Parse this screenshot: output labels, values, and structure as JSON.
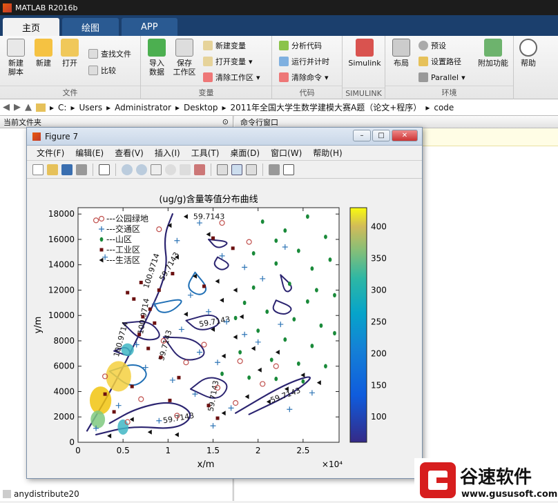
{
  "app": {
    "title": "MATLAB R2016b"
  },
  "tabs": [
    {
      "label": "主页",
      "active": true
    },
    {
      "label": "绘图",
      "active": false
    },
    {
      "label": "APP",
      "active": false
    }
  ],
  "ribbon": {
    "file_group": {
      "name": "文件",
      "new_script": "新建\n脚本",
      "new": "新建",
      "open": "打开",
      "find_files": "查找文件",
      "compare": "比较"
    },
    "variable_group": {
      "name": "变量",
      "import": "导入\n数据",
      "save_ws": "保存\n工作区",
      "new_var": "新建变量",
      "open_var": "打开变量",
      "clear_ws": "清除工作区"
    },
    "code_group": {
      "name": "代码",
      "analyze": "分析代码",
      "run_time": "运行并计时",
      "clear_cmd": "清除命令"
    },
    "simulink_group": {
      "name": "SIMULINK",
      "simulink": "Simulink"
    },
    "env_group": {
      "name": "环境",
      "layout": "布局",
      "prefs": "预设",
      "set_path": "设置路径",
      "parallel": "Parallel",
      "addons": "附加功能"
    },
    "help": "帮助"
  },
  "address": {
    "path": [
      "C:",
      "Users",
      "Administrator",
      "Desktop",
      "2011年全国大学生数学建模大赛A题（论文+程序）",
      "code"
    ]
  },
  "left_panel": {
    "title": "当前文件夹",
    "bottom_item": "anydistribute20"
  },
  "right_panel": {
    "title": "命令行窗口"
  },
  "figure": {
    "title": "Figure 7",
    "menu": [
      "文件(F)",
      "编辑(E)",
      "查看(V)",
      "插入(I)",
      "工具(T)",
      "桌面(D)",
      "窗口(W)",
      "帮助(H)"
    ]
  },
  "chart_data": {
    "type": "scatter",
    "title": "(ug/g)含量等值分布曲线",
    "xlabel": "x/m",
    "ylabel": "y/m",
    "x_multiplier": "×10⁴",
    "xlim": [
      0,
      2.9
    ],
    "ylim": [
      0,
      18500
    ],
    "xticks": [
      "0",
      "0.5",
      "1",
      "1.5",
      "2",
      "2.5"
    ],
    "yticks": [
      "0",
      "2000",
      "4000",
      "6000",
      "8000",
      "10000",
      "12000",
      "14000",
      "16000",
      "18000"
    ],
    "colorbar": {
      "ticks": [
        "100",
        "150",
        "200",
        "250",
        "300",
        "350",
        "400"
      ],
      "range": [
        60,
        430
      ]
    },
    "legend": [
      {
        "name": "---公园绿地",
        "marker": "circle",
        "color": "#c0504d"
      },
      {
        "name": "---交通区",
        "marker": "plus",
        "color": "#2e75b6"
      },
      {
        "name": "---山区",
        "marker": "dot",
        "color": "#1a8a3a"
      },
      {
        "name": "---工业区",
        "marker": "square",
        "color": "#6b1010"
      },
      {
        "name": "---生活区",
        "marker": "triangle",
        "color": "#111111"
      }
    ],
    "contour_labels": [
      "59.7143",
      "59.7143",
      "59.7143",
      "59.7143",
      "59.7143",
      "59.7143",
      "59.7143",
      "100.9714",
      "100.9714",
      "100.9714"
    ],
    "series": [
      {
        "name": "---公园绿地",
        "points": [
          [
            0.2,
            17500
          ],
          [
            0.9,
            16800
          ],
          [
            1.6,
            17300
          ],
          [
            1.9,
            15800
          ],
          [
            0.3,
            5200
          ],
          [
            0.7,
            3400
          ],
          [
            1.2,
            6300
          ],
          [
            0.95,
            8000
          ],
          [
            1.4,
            7700
          ],
          [
            1.8,
            6400
          ],
          [
            1.55,
            4300
          ],
          [
            2.05,
            4600
          ],
          [
            1.1,
            2100
          ],
          [
            0.55,
            1600
          ],
          [
            1.75,
            3100
          ],
          [
            2.2,
            6000
          ]
        ]
      },
      {
        "name": "---交通区",
        "points": [
          [
            0.3,
            14600
          ],
          [
            1.1,
            15900
          ],
          [
            1.35,
            17300
          ],
          [
            1.6,
            14700
          ],
          [
            2.3,
            15400
          ],
          [
            1.85,
            13800
          ],
          [
            2.05,
            12900
          ],
          [
            1.25,
            11600
          ],
          [
            0.85,
            10900
          ],
          [
            1.45,
            10300
          ],
          [
            1.65,
            9500
          ],
          [
            1.15,
            8900
          ],
          [
            0.65,
            7700
          ],
          [
            1.35,
            7100
          ],
          [
            1.85,
            8500
          ],
          [
            2.25,
            9300
          ],
          [
            1.55,
            6300
          ],
          [
            0.75,
            5900
          ],
          [
            1.05,
            4900
          ],
          [
            1.3,
            3800
          ],
          [
            1.7,
            2700
          ],
          [
            2.35,
            2600
          ],
          [
            0.45,
            2900
          ],
          [
            0.9,
            1700
          ],
          [
            1.5,
            1300
          ],
          [
            0.2,
            1100
          ],
          [
            2.0,
            7900
          ],
          [
            2.6,
            3900
          ]
        ]
      },
      {
        "name": "---山区",
        "points": [
          [
            2.05,
            17400
          ],
          [
            2.3,
            16700
          ],
          [
            2.55,
            17800
          ],
          [
            2.75,
            16200
          ],
          [
            2.45,
            15100
          ],
          [
            2.2,
            14100
          ],
          [
            2.6,
            13700
          ],
          [
            1.95,
            12200
          ],
          [
            2.35,
            12500
          ],
          [
            2.65,
            12000
          ],
          [
            2.8,
            14400
          ],
          [
            1.85,
            11000
          ],
          [
            2.1,
            10300
          ],
          [
            2.4,
            9700
          ],
          [
            2.7,
            9200
          ],
          [
            2.0,
            8800
          ],
          [
            2.3,
            8100
          ],
          [
            2.6,
            7600
          ],
          [
            2.85,
            8600
          ],
          [
            1.8,
            7100
          ],
          [
            2.15,
            6500
          ],
          [
            2.45,
            6200
          ],
          [
            2.75,
            6000
          ],
          [
            1.6,
            5400
          ],
          [
            1.9,
            5100
          ],
          [
            2.2,
            5000
          ],
          [
            2.5,
            4800
          ],
          [
            1.75,
            9800
          ],
          [
            2.55,
            11100
          ],
          [
            2.85,
            11600
          ],
          [
            1.95,
            14900
          ],
          [
            2.2,
            15900
          ]
        ]
      },
      {
        "name": "---工业区",
        "points": [
          [
            0.55,
            11800
          ],
          [
            0.62,
            11300
          ],
          [
            0.7,
            12600
          ],
          [
            0.72,
            9900
          ],
          [
            0.8,
            10500
          ],
          [
            0.68,
            8500
          ],
          [
            0.85,
            9400
          ],
          [
            0.92,
            6700
          ],
          [
            0.78,
            7400
          ],
          [
            1.12,
            5100
          ],
          [
            0.6,
            4400
          ],
          [
            1.02,
            3300
          ],
          [
            1.45,
            2900
          ],
          [
            1.55,
            1900
          ],
          [
            1.4,
            12300
          ],
          [
            1.72,
            15300
          ],
          [
            1.5,
            16100
          ],
          [
            1.05,
            13300
          ],
          [
            0.9,
            12000
          ],
          [
            0.3,
            3800
          ],
          [
            0.4,
            2400
          ]
        ]
      },
      {
        "name": "---生活区",
        "points": [
          [
            1.02,
            17100
          ],
          [
            1.2,
            17800
          ],
          [
            1.45,
            16400
          ],
          [
            1.1,
            14600
          ],
          [
            1.3,
            13100
          ],
          [
            1.55,
            12700
          ],
          [
            1.75,
            12000
          ],
          [
            1.6,
            11200
          ],
          [
            1.82,
            9900
          ],
          [
            1.5,
            8900
          ],
          [
            1.2,
            10100
          ],
          [
            1.75,
            8300
          ],
          [
            1.95,
            7400
          ],
          [
            1.62,
            6800
          ],
          [
            2.02,
            5700
          ],
          [
            2.32,
            4200
          ],
          [
            1.88,
            3600
          ],
          [
            1.62,
            2300
          ],
          [
            2.12,
            3200
          ],
          [
            0.6,
            1800
          ],
          [
            0.8,
            800
          ],
          [
            1.1,
            600
          ],
          [
            0.35,
            500
          ],
          [
            2.5,
            5300
          ],
          [
            2.68,
            4700
          ],
          [
            2.22,
            7100
          ]
        ]
      }
    ]
  }
}
